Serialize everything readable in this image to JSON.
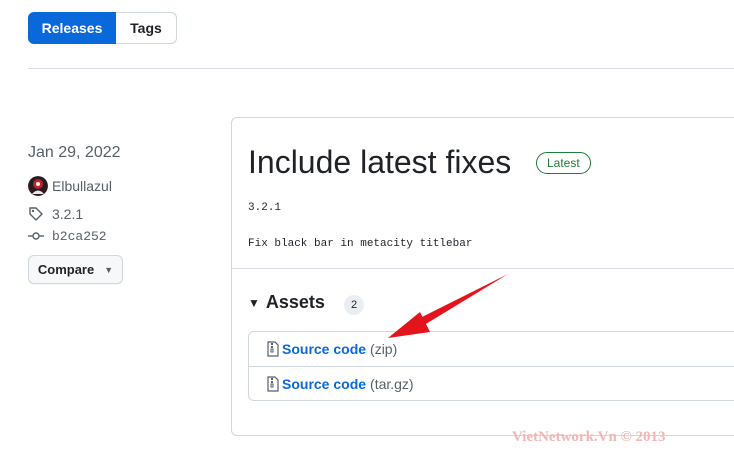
{
  "tabs": {
    "releases": "Releases",
    "tags": "Tags"
  },
  "release": {
    "date": "Jan 29, 2022",
    "author": "Elbullazul",
    "tag": "3.2.1",
    "commit": "b2ca252",
    "compare_label": "Compare",
    "title": "Include latest fixes",
    "badge": "Latest",
    "version_text": "3.2.1",
    "notes": "Fix black bar in metacity titlebar"
  },
  "assets": {
    "label": "Assets",
    "count": "2",
    "items": [
      {
        "name": "Source code",
        "ext": "(zip)"
      },
      {
        "name": "Source code",
        "ext": "(tar.gz)"
      }
    ]
  },
  "watermark": "VietNetwork.Vn © 2013",
  "colors": {
    "primary": "#0969da",
    "latest": "#1a7f37",
    "annotation_arrow": "#e3141b"
  },
  "icons": [
    "tag-icon",
    "commit-icon",
    "file-zip-icon",
    "triangle-down-icon",
    "avatar"
  ]
}
